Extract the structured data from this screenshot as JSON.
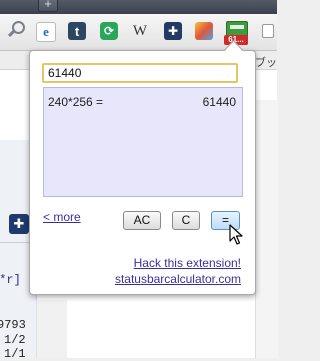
{
  "browser": {
    "new_tab_label": "+",
    "bookmark_text": "ブッ",
    "toolbar_icons": [
      "search-icon",
      "ie-tab-icon",
      "tumblr-icon",
      "sync-icon",
      "wikipedia-icon",
      "puzzle-icon",
      "photo-icon",
      "calculator-icon"
    ],
    "wikipedia_label": "W",
    "tumblr_label": "t",
    "calc_badge": "61..."
  },
  "background_page": {
    "code_lines": [
      "f*r]",
      "9793",
      "1/2",
      "1/1"
    ]
  },
  "calculator": {
    "input_value": "61440",
    "history": [
      {
        "expression": "240*256 =",
        "result": "61440"
      }
    ],
    "more_label": "< more",
    "ac_label": "AC",
    "c_label": "C",
    "equals_label": "=",
    "hack_label": "Hack this extension!",
    "site_label": "statusbarcalculator.com"
  }
}
